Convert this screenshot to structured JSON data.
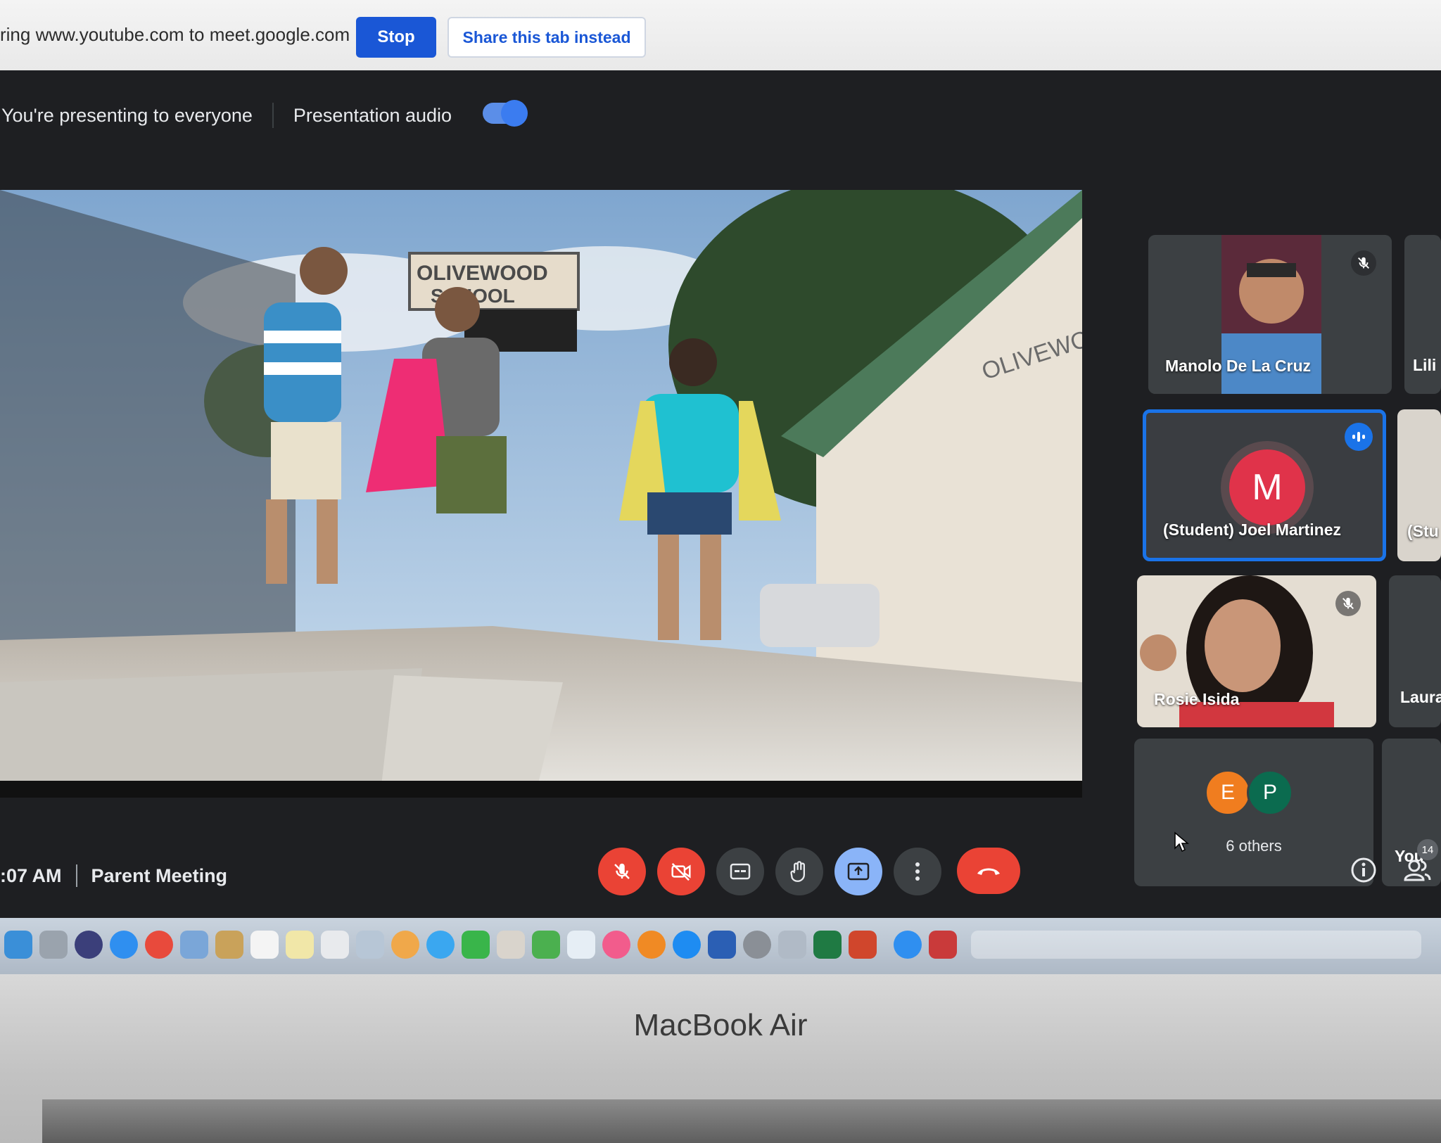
{
  "share_banner": {
    "message": "ring www.youtube.com to meet.google.com",
    "stop_label": "Stop",
    "share_tab_label": "Share this tab instead"
  },
  "presenting_bar": {
    "status": "You're presenting to everyone",
    "audio_label": "Presentation audio",
    "audio_enabled": true
  },
  "participants": [
    {
      "name": "Manolo De La Cruz",
      "muted": true
    },
    {
      "name": "(Student) Joel Martinez",
      "initial": "M",
      "speaking": true
    },
    {
      "name": "Rosie Isida",
      "muted": true
    },
    {
      "label": "6 others",
      "initials": [
        "E",
        "P"
      ]
    }
  ],
  "edge_tiles": [
    "Lili",
    "(Stu",
    "Laura",
    "You"
  ],
  "meeting": {
    "time": ":07 AM",
    "title": "Parent Meeting"
  },
  "controls": [
    "mic-off-icon",
    "camera-off-icon",
    "captions-icon",
    "raise-hand-icon",
    "present-icon",
    "more-options-icon",
    "end-call-icon"
  ],
  "people_count": "14",
  "video_overlay": {
    "sign_line1": "OLIVEWOOD",
    "sign_line2": "SCHOOL",
    "wall_text": "OLIVEWO"
  },
  "laptop_brand": "MacBook Air",
  "colors": {
    "accent": "#1a73e8",
    "danger": "#ea4335",
    "surface": "#3c4043"
  }
}
